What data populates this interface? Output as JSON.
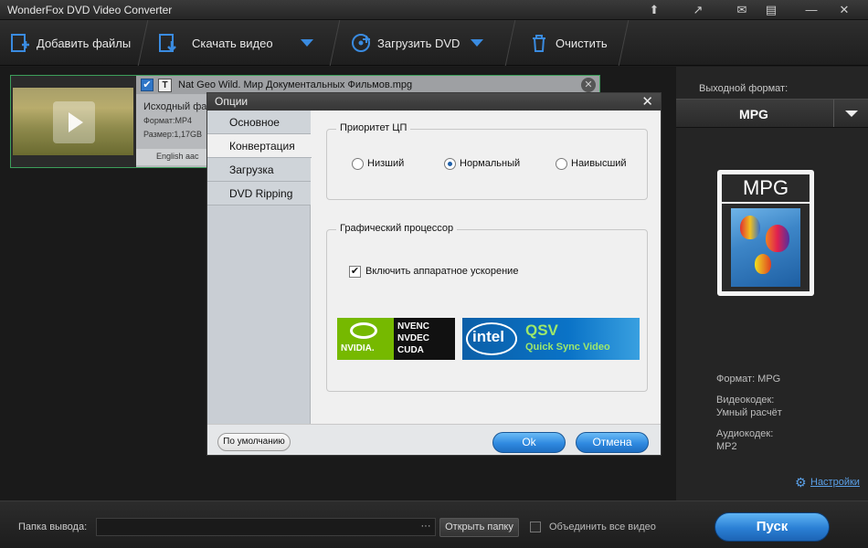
{
  "app": {
    "title": "WonderFox DVD Video Converter"
  },
  "toolbar": {
    "add_files": "Добавить файлы",
    "download_video": "Скачать видео",
    "load_dvd": "Загрузить DVD",
    "clear": "Очистить"
  },
  "file": {
    "name": "Nat Geo Wild. Мир Документальных Фильмов.mpg",
    "source_label": "Исходный фай",
    "format": "Формат:MP4",
    "size": "Размер:1,17GB",
    "audio": "English aac"
  },
  "output_panel": {
    "label": "Выходной формат:",
    "format": "MPG",
    "icon_label": "MPG",
    "info": {
      "format": "Формат: MPG",
      "video_codec_label": "Видеокодек:",
      "video_codec_value": "Умный расчёт",
      "audio_codec_label": "Аудиокодек:",
      "audio_codec_value": "MP2"
    },
    "settings_link": "Настройки"
  },
  "bottom": {
    "output_folder_label": "Папка вывода:",
    "output_folder_value": "",
    "browse": "···",
    "open_folder": "Открыть папку",
    "merge_label": "Объединить все видео",
    "start": "Пуск"
  },
  "dialog": {
    "title": "Опции",
    "nav": [
      "Основное",
      "Конвертация",
      "Загрузка",
      "DVD Ripping"
    ],
    "active_nav": 1,
    "cpu_group": {
      "title": "Приоритет ЦП",
      "options": [
        "Низший",
        "Нормальный",
        "Наивысший"
      ],
      "selected": 1
    },
    "gpu_group": {
      "title": "Графический процессор",
      "hw_accel_label": "Включить аппаратное ускорение",
      "hw_accel_checked": true,
      "nvidia": {
        "brand": "NVIDIA.",
        "lines": [
          "NVENC",
          "NVDEC",
          "CUDA"
        ]
      },
      "intel": {
        "brand": "intel",
        "name": "QSV",
        "sub": "Quick Sync Video"
      }
    },
    "default_btn": "По умолчанию",
    "ok_btn": "Ok",
    "cancel_btn": "Отмена"
  }
}
